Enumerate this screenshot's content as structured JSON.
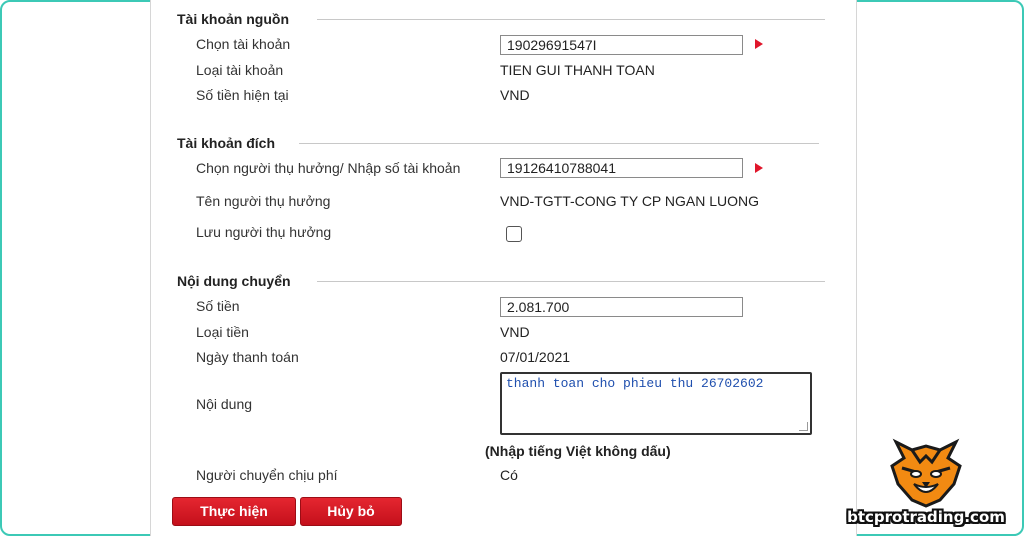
{
  "source": {
    "title": "Tài khoản nguồn",
    "select_account_label": "Chọn tài khoản",
    "select_account_value": "19029691547I",
    "account_type_label": "Loại tài khoản",
    "account_type_value": "TIEN GUI THANH TOAN",
    "current_balance_label": "Số tiền hiện tại",
    "current_balance_value": "VND"
  },
  "destination": {
    "title": "Tài khoản đích",
    "beneficiary_label": "Chọn người thụ hưởng/ Nhập số tài khoản",
    "beneficiary_value": "19126410788041",
    "beneficiary_name_label": "Tên người thụ hưởng",
    "beneficiary_name_value": "VND-TGTT-CONG TY CP NGAN LUONG",
    "save_beneficiary_label": "Lưu người thụ hưởng",
    "save_beneficiary_checked": false
  },
  "transfer": {
    "title": "Nội dung chuyển",
    "amount_label": "Số tiền",
    "amount_value": "2.081.700",
    "currency_label": "Loại tiền",
    "currency_value": "VND",
    "payment_date_label": "Ngày thanh toán",
    "payment_date_value": "07/01/2021",
    "content_label": "Nội dung",
    "content_value": "thanh toan cho phieu thu 26702602",
    "content_note": "(Nhập tiếng Việt không dấu)",
    "fee_payer_label": "Người chuyển chịu phí",
    "fee_payer_value": "Có"
  },
  "actions": {
    "submit_label": "Thực hiện",
    "cancel_label": "Hủy bỏ"
  },
  "watermark": {
    "brand_text": "btcprotrading.com"
  },
  "colors": {
    "accent_red": "#d4121e",
    "frame_border": "#3cc9b6"
  }
}
